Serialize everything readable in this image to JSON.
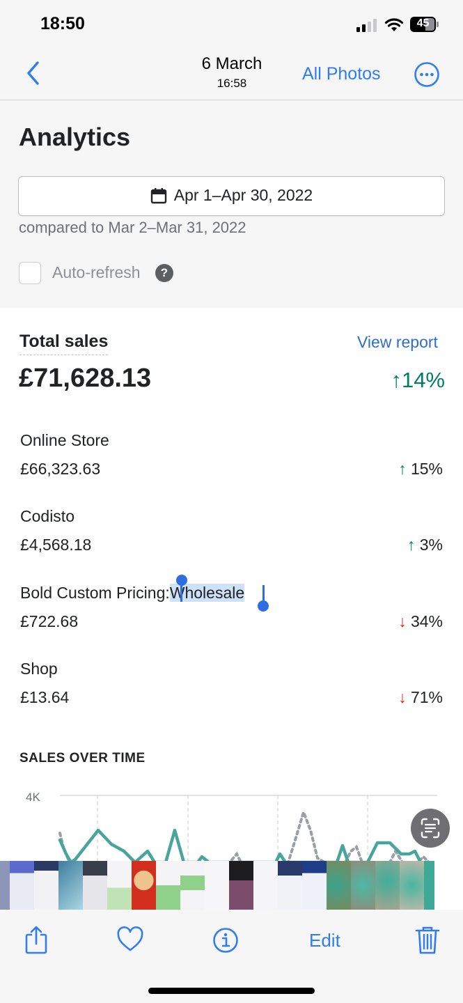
{
  "status_bar": {
    "time": "18:50",
    "battery": "45"
  },
  "nav": {
    "date": "6 March",
    "time": "16:58",
    "all_photos": "All Photos"
  },
  "analytics": {
    "title": "Analytics",
    "date_range": "Apr 1–Apr 30, 2022",
    "compared_to": "compared to Mar 2–Mar 31, 2022",
    "auto_refresh": "Auto-refresh",
    "auto_refresh_checked": false,
    "help": "?"
  },
  "total_sales": {
    "label": "Total sales",
    "view_report": "View report",
    "value": "£71,628.13",
    "change": "14%",
    "direction": "up"
  },
  "channels": [
    {
      "name": "Online Store",
      "value": "£66,323.63",
      "change": "15%",
      "direction": "up"
    },
    {
      "name": "Codisto",
      "value": "£4,568.18",
      "change": "3%",
      "direction": "up"
    },
    {
      "name_prefix": "Bold Custom Pricing:",
      "name_selected": "Wholesale",
      "value": "£722.68",
      "change": "34%",
      "direction": "down"
    },
    {
      "name": "Shop",
      "value": "£13.64",
      "change": "71%",
      "direction": "down"
    }
  ],
  "sales_over_time": {
    "title": "SALES OVER TIME",
    "y_tick": "4K"
  },
  "toolbar": {
    "edit": "Edit"
  },
  "colors": {
    "ios_blue": "#2f7cf6",
    "polaris_blue": "#2c6ecb",
    "up_green": "#007f5f",
    "down_red": "#d72c0d",
    "chart_line": "#47a59e",
    "chart_dotted": "#9a9ea8"
  },
  "icons": [
    "back-chevron-icon",
    "more-icon",
    "calendar-icon",
    "help-icon",
    "live-text-icon",
    "share-icon",
    "heart-icon",
    "info-icon",
    "trash-icon"
  ]
}
